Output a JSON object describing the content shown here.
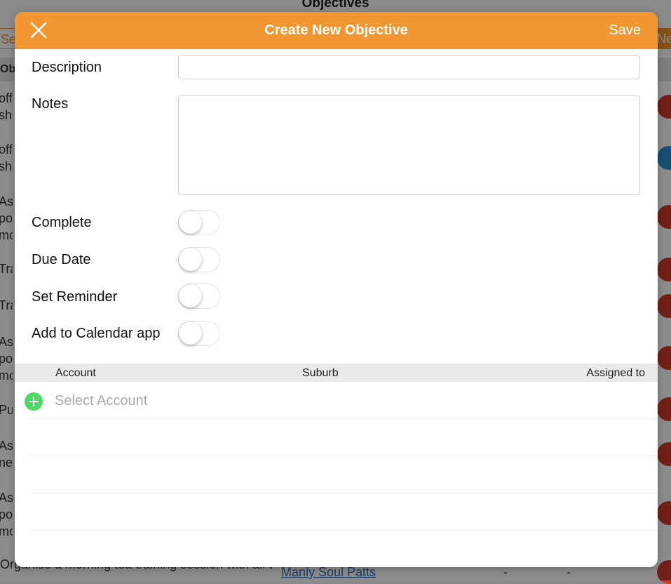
{
  "background": {
    "page_title": "Objectives",
    "search_fragment": "Se",
    "new_fragment": "Ne",
    "column_fragment": "Obj",
    "row_fragments": [
      [
        "offe",
        "she"
      ],
      [
        "offe",
        "she"
      ],
      [
        "Ask",
        "pos",
        "mo"
      ],
      [
        "Tra"
      ],
      [
        "Tra"
      ],
      [
        "Ask",
        "pos",
        "mo"
      ],
      [
        "Put"
      ],
      [
        "Ask",
        "nex"
      ],
      [
        "Ask",
        "pos",
        "mo"
      ]
    ],
    "bottom_row_text": "Organise a morning tea training session with all the staff",
    "bottom_row_account": "Manly Soul Patts",
    "bottom_row_dash": "-"
  },
  "modal": {
    "title": "Create New Objective",
    "save_label": "Save",
    "description_label": "Description",
    "description_value": "",
    "notes_label": "Notes",
    "notes_value": "",
    "complete_label": "Complete",
    "complete_on": false,
    "due_date_label": "Due Date",
    "due_date_on": false,
    "set_reminder_label": "Set Reminder",
    "set_reminder_on": false,
    "add_to_calendar_label": "Add to Calendar app",
    "add_to_calendar_on": false,
    "table": {
      "col_account": "Account",
      "col_suburb": "Suburb",
      "col_assigned": "Assigned to"
    },
    "select_account_label": "Select Account"
  },
  "colors": {
    "accent": "#f29632",
    "add_green": "#4cd964"
  },
  "icons": {
    "close": "close-icon",
    "add": "plus-circle-icon"
  }
}
